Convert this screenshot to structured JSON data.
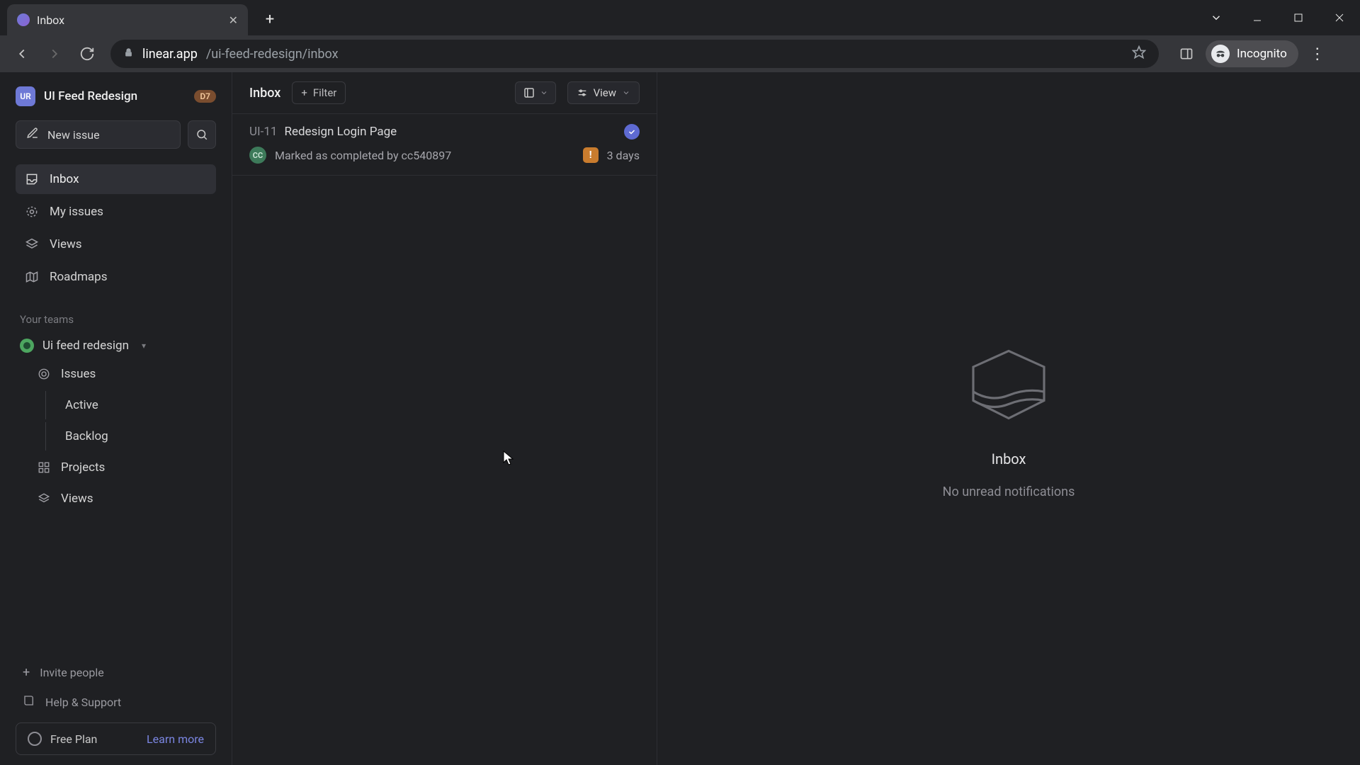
{
  "browser": {
    "tab_title": "Inbox",
    "url_host": "linear.app",
    "url_path": "/ui-feed-redesign/inbox",
    "incognito_label": "Incognito"
  },
  "sidebar": {
    "workspace_initials": "UR",
    "workspace_name": "UI Feed Redesign",
    "workspace_badge": "D7",
    "new_issue_label": "New issue",
    "nav": {
      "inbox": "Inbox",
      "my_issues": "My issues",
      "views": "Views",
      "roadmaps": "Roadmaps"
    },
    "teams_label": "Your teams",
    "team_name": "Ui feed redesign",
    "team_items": {
      "issues": "Issues",
      "active": "Active",
      "backlog": "Backlog",
      "projects": "Projects",
      "views": "Views"
    },
    "invite_label": "Invite people",
    "help_label": "Help & Support",
    "plan_label": "Free Plan",
    "learn_more": "Learn more"
  },
  "center": {
    "title": "Inbox",
    "filter_label": "Filter",
    "view_label": "View",
    "notification": {
      "issue_id": "UI-11",
      "issue_title": "Redesign Login Page",
      "user_initials": "CC",
      "status_text": "Marked as completed by cc540897",
      "priority_glyph": "!",
      "age": "3 days"
    }
  },
  "right": {
    "empty_title": "Inbox",
    "empty_subtitle": "No unread notifications"
  }
}
